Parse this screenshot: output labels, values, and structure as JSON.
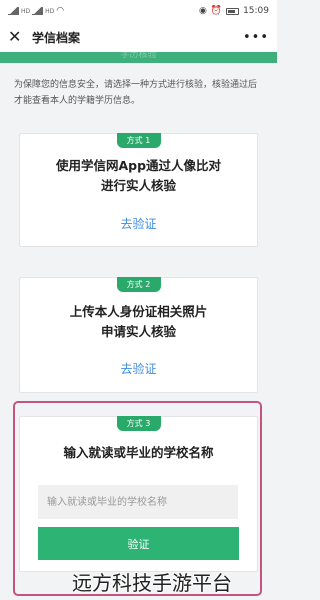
{
  "status_bar": {
    "left_tags": [
      "HD",
      "HD"
    ],
    "time": "15:09",
    "icons": [
      "signal-icon",
      "wifi-icon",
      "eye-icon",
      "alarm-icon",
      "battery-icon"
    ]
  },
  "nav": {
    "close_icon": "close-icon",
    "title": "学信档案",
    "more": "•••"
  },
  "header_band_text": "学历核验",
  "notice": "为保障您的信息安全，请选择一种方式进行核验，核验通过后才能查看本人的学籍学历信息。",
  "methods": [
    {
      "tag": "方式 1",
      "title_lines": [
        "使用学信网App通过人像比对",
        "进行实人核验"
      ],
      "link": "去验证"
    },
    {
      "tag": "方式 2",
      "title_lines": [
        "上传本人身份证相关照片",
        "申请实人核验"
      ],
      "link": "去验证"
    },
    {
      "tag": "方式 3",
      "title_lines": [
        "输入就读或毕业的学校名称"
      ],
      "input_placeholder": "输入就读或毕业的学校名称",
      "button": "验证"
    }
  ],
  "watermark": "远方科技手游平台",
  "colors": {
    "accent_green": "#2db374",
    "link_blue": "#3d8de0",
    "highlight_frame": "#c2547d"
  }
}
